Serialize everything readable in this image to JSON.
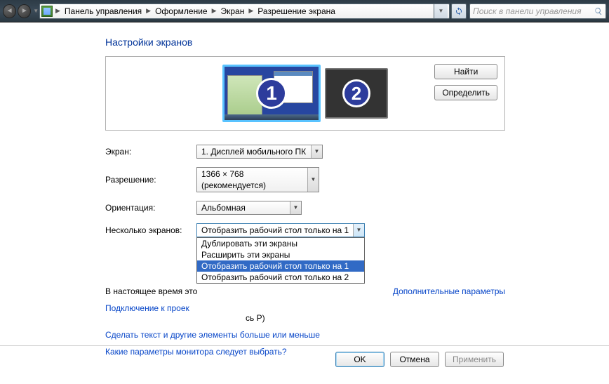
{
  "addressbar": {
    "crumbs": [
      "Панель управления",
      "Оформление",
      "Экран",
      "Разрешение экрана"
    ],
    "search_placeholder": "Поиск в панели управления"
  },
  "page_title": "Настройки экранов",
  "preview": {
    "monitor1_number": "1",
    "monitor2_number": "2",
    "btn_find": "Найти",
    "btn_identify": "Определить"
  },
  "labels": {
    "screen": "Экран:",
    "resolution": "Разрешение:",
    "orientation": "Ориентация:",
    "multiple": "Несколько экранов:"
  },
  "values": {
    "screen": "1. Дисплей мобильного ПК",
    "resolution": "1366 × 768 (рекомендуется)",
    "orientation": "Альбомная",
    "multiple": "Отобразить рабочий стол только на 1"
  },
  "multi_options": {
    "items": [
      "Дублировать эти экраны",
      "Расширить эти экраны",
      "Отобразить рабочий стол только на 1",
      "Отобразить рабочий стол только на 2"
    ],
    "selected_index": 2
  },
  "plain_text": {
    "current_prefix": "В настоящее время это",
    "projector_suffix": "сь P)"
  },
  "links": {
    "advanced": "Дополнительные параметры",
    "projector": "Подключение к проек",
    "text_size": "Сделать текст и другие элементы больше или меньше",
    "monitor_help": "Какие параметры монитора следует выбрать?"
  },
  "footer": {
    "ok": "OK",
    "cancel": "Отмена",
    "apply": "Применить"
  }
}
